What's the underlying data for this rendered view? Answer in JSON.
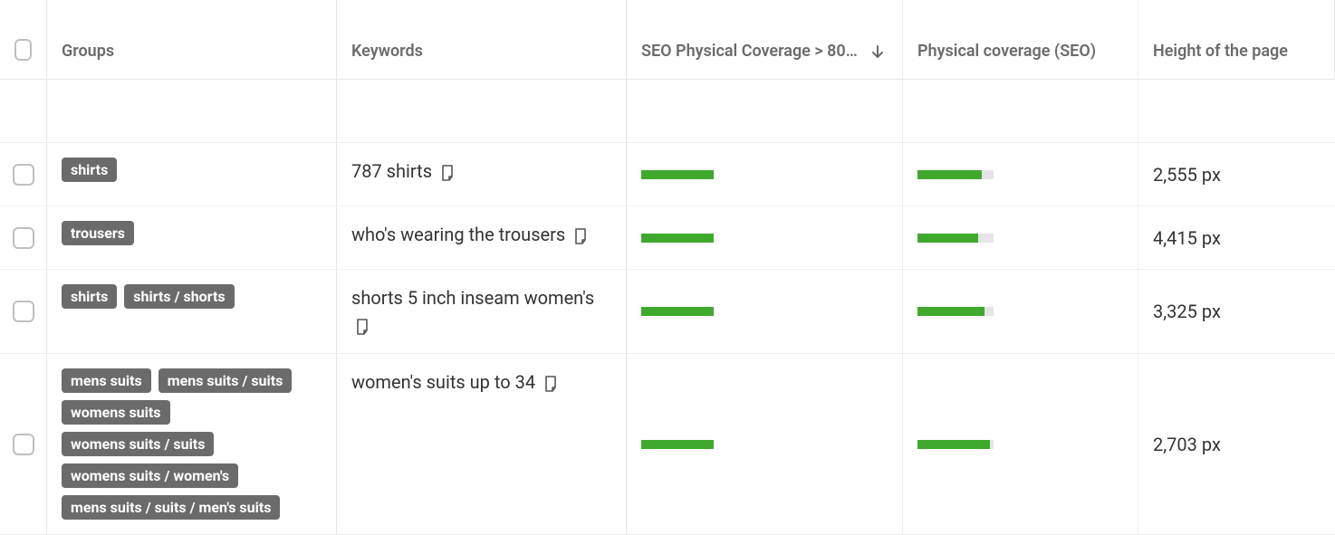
{
  "columns": {
    "groups": "Groups",
    "keywords": "Keywords",
    "seo_coverage_80": "SEO Physical Coverage > 80…",
    "physical_coverage": "Physical coverage (SEO)",
    "height": "Height of the page"
  },
  "sort": {
    "column": "seo_coverage_80",
    "direction": "desc"
  },
  "rows": [
    {
      "groups": [
        "shirts"
      ],
      "keyword": "787 shirts",
      "seo80_bar_pct": 100,
      "physical_bar_pct": 85,
      "height": "2,555 px"
    },
    {
      "groups": [
        "trousers"
      ],
      "keyword": "who's wearing the trousers",
      "seo80_bar_pct": 100,
      "physical_bar_pct": 80,
      "height": "4,415 px"
    },
    {
      "groups": [
        "shirts",
        "shirts / shorts"
      ],
      "keyword": "shorts 5 inch inseam women's",
      "seo80_bar_pct": 100,
      "physical_bar_pct": 88,
      "height": "3,325 px"
    },
    {
      "groups": [
        "mens suits",
        "mens suits / suits",
        "womens suits",
        "womens suits / suits",
        "womens suits / women's",
        "mens suits / suits / men's suits"
      ],
      "keyword": "women's suits up to 34",
      "seo80_bar_pct": 100,
      "physical_bar_pct": 95,
      "height": "2,703 px"
    }
  ]
}
